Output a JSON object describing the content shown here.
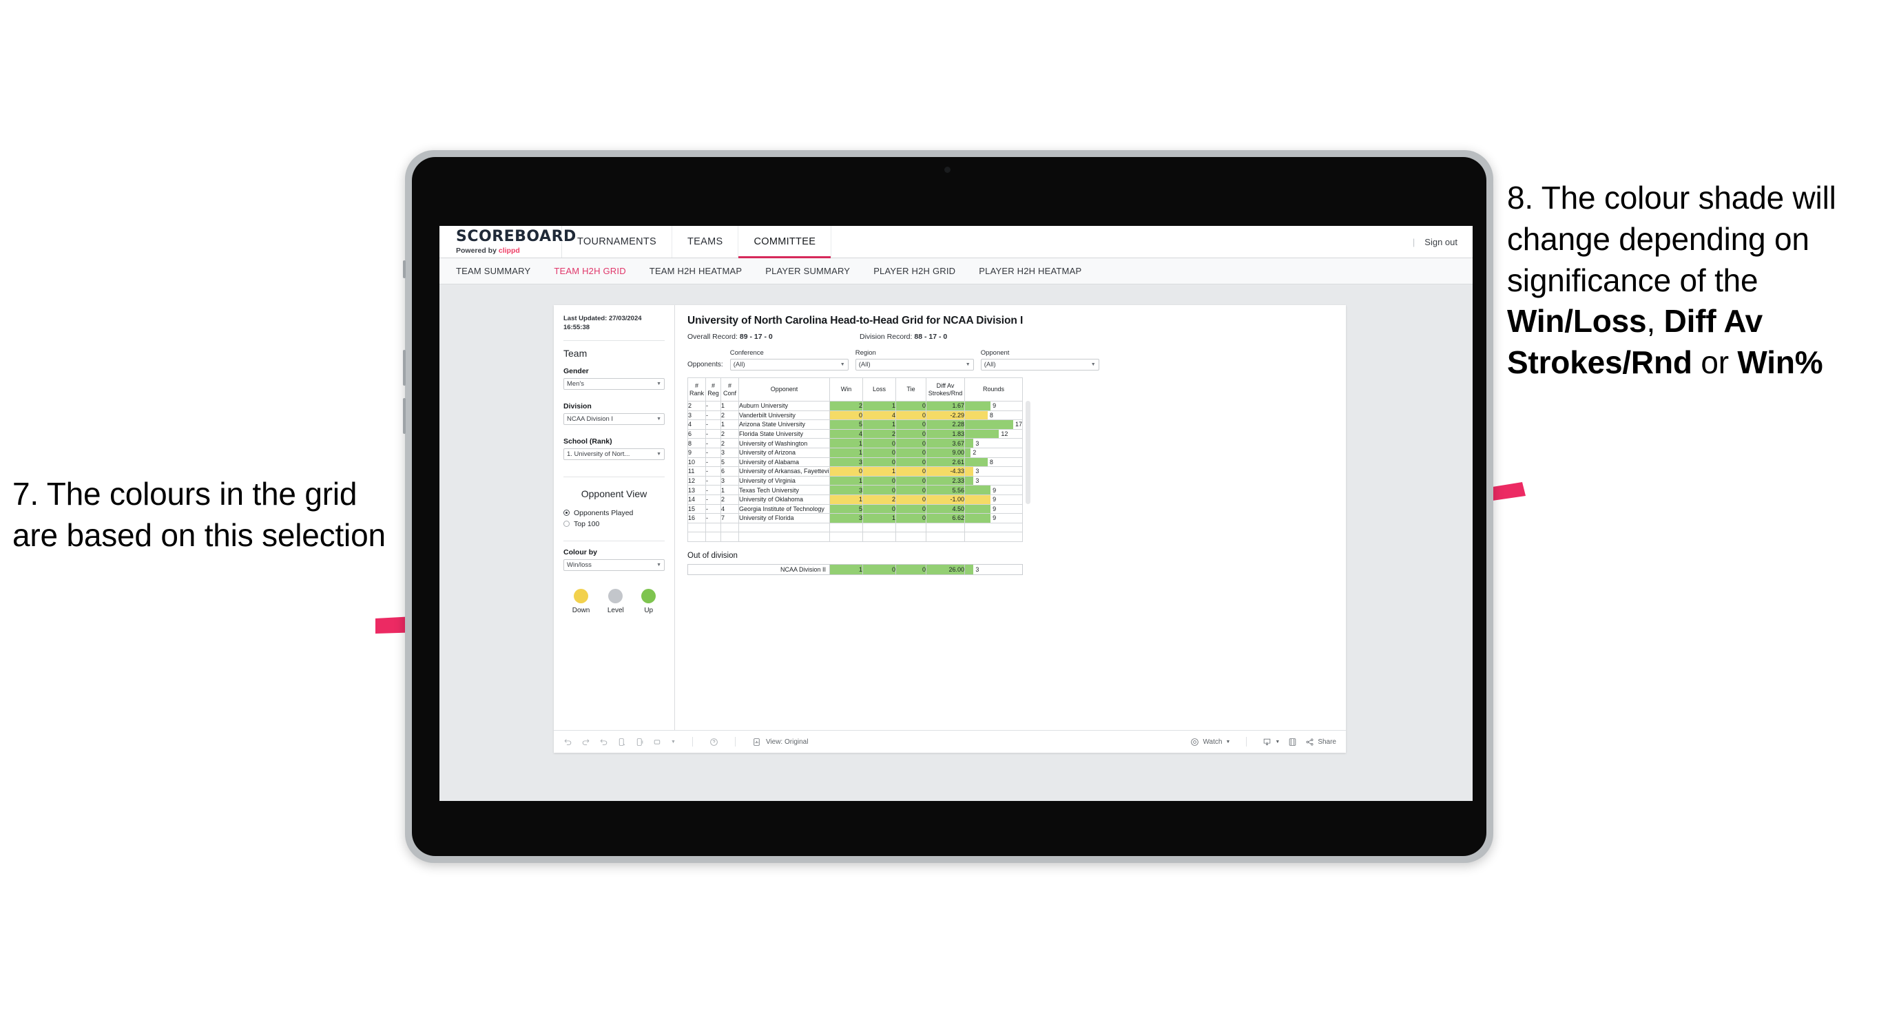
{
  "annotations": {
    "left": {
      "number": "7.",
      "text": "7. The colours in the grid are based on this selection"
    },
    "right": {
      "lead": "8. The colour shade will change depending on significance of the ",
      "bold1": "Win/Loss",
      "mid1": ", ",
      "bold2": "Diff Av Strokes/Rnd",
      "mid2": " or ",
      "bold3": "Win%",
      "arrow_color": "#ec2a63"
    }
  },
  "app": {
    "brand": {
      "name": "SCOREBOARD",
      "powered_prefix": "Powered by ",
      "powered_brand": "clippd"
    },
    "top_nav": [
      {
        "label": "TOURNAMENTS",
        "active": false
      },
      {
        "label": "TEAMS",
        "active": false
      },
      {
        "label": "COMMITTEE",
        "active": true
      }
    ],
    "sign_out": "Sign out",
    "separator": "|",
    "sub_nav": [
      {
        "label": "TEAM SUMMARY",
        "active": false
      },
      {
        "label": "TEAM H2H GRID",
        "active": true
      },
      {
        "label": "TEAM H2H HEATMAP",
        "active": false
      },
      {
        "label": "PLAYER SUMMARY",
        "active": false
      },
      {
        "label": "PLAYER H2H GRID",
        "active": false
      },
      {
        "label": "PLAYER H2H HEATMAP",
        "active": false
      }
    ]
  },
  "sidebar": {
    "last_updated": "Last Updated: 27/03/2024 16:55:38",
    "team_heading": "Team",
    "gender": {
      "label": "Gender",
      "value": "Men's"
    },
    "division": {
      "label": "Division",
      "value": "NCAA Division I"
    },
    "school": {
      "label": "School (Rank)",
      "value": "1. University of Nort..."
    },
    "opponent_view": {
      "heading": "Opponent View",
      "options": [
        {
          "label": "Opponents Played",
          "selected": true
        },
        {
          "label": "Top 100",
          "selected": false
        }
      ]
    },
    "colour_by": {
      "label": "Colour by",
      "value": "Win/loss"
    },
    "legend": [
      {
        "label": "Down",
        "color": "#f2d14d"
      },
      {
        "label": "Level",
        "color": "#c3c6cb"
      },
      {
        "label": "Up",
        "color": "#7ec44f"
      }
    ]
  },
  "main": {
    "title": "University of North Carolina Head-to-Head Grid for NCAA Division I",
    "overall_record_label": "Overall Record: ",
    "overall_record_value": "89 - 17 - 0",
    "division_record_label": "Division Record: ",
    "division_record_value": "88 - 17 - 0",
    "opponents_label": "Opponents:",
    "filters": [
      {
        "label": "Conference",
        "value": "(All)"
      },
      {
        "label": "Region",
        "value": "(All)"
      },
      {
        "label": "Opponent",
        "value": "(All)"
      }
    ]
  },
  "chart_data": {
    "type": "table",
    "title": "University of North Carolina Head-to-Head Grid for NCAA Division I",
    "columns": [
      "# Rank",
      "# Reg",
      "# Conf",
      "Opponent",
      "Win",
      "Loss",
      "Tie",
      "Diff Av Strokes/Rnd",
      "Rounds"
    ],
    "column_headers_two_line": [
      [
        "#",
        "Rank"
      ],
      [
        "#",
        "Reg"
      ],
      [
        "#",
        "Conf"
      ],
      [
        "",
        "Opponent"
      ],
      [
        "",
        "Win"
      ],
      [
        "",
        "Loss"
      ],
      [
        "",
        "Tie"
      ],
      [
        "Diff Av",
        "Strokes/Rnd"
      ],
      [
        "",
        "Rounds"
      ]
    ],
    "rounds_max": 17,
    "colors": {
      "up": "#93cf73",
      "down": "#f5db66",
      "level": "#c3c6cb"
    },
    "rows": [
      {
        "rank": "2",
        "reg": "-",
        "conf": "1",
        "opponent": "Auburn University",
        "win": 2,
        "loss": 1,
        "tie": 0,
        "diff": "1.67",
        "rounds": 9,
        "state": "up"
      },
      {
        "rank": "3",
        "reg": "-",
        "conf": "2",
        "opponent": "Vanderbilt University",
        "win": 0,
        "loss": 4,
        "tie": 0,
        "diff": "-2.29",
        "rounds": 8,
        "state": "down"
      },
      {
        "rank": "4",
        "reg": "-",
        "conf": "1",
        "opponent": "Arizona State University",
        "win": 5,
        "loss": 1,
        "tie": 0,
        "diff": "2.28",
        "rounds": 17,
        "state": "up"
      },
      {
        "rank": "6",
        "reg": "-",
        "conf": "2",
        "opponent": "Florida State University",
        "win": 4,
        "loss": 2,
        "tie": 0,
        "diff": "1.83",
        "rounds": 12,
        "state": "up"
      },
      {
        "rank": "8",
        "reg": "-",
        "conf": "2",
        "opponent": "University of Washington",
        "win": 1,
        "loss": 0,
        "tie": 0,
        "diff": "3.67",
        "rounds": 3,
        "state": "up"
      },
      {
        "rank": "9",
        "reg": "-",
        "conf": "3",
        "opponent": "University of Arizona",
        "win": 1,
        "loss": 0,
        "tie": 0,
        "diff": "9.00",
        "rounds": 2,
        "state": "up"
      },
      {
        "rank": "10",
        "reg": "-",
        "conf": "5",
        "opponent": "University of Alabama",
        "win": 3,
        "loss": 0,
        "tie": 0,
        "diff": "2.61",
        "rounds": 8,
        "state": "up"
      },
      {
        "rank": "11",
        "reg": "-",
        "conf": "6",
        "opponent": "University of Arkansas, Fayetteville",
        "win": 0,
        "loss": 1,
        "tie": 0,
        "diff": "-4.33",
        "rounds": 3,
        "state": "down"
      },
      {
        "rank": "12",
        "reg": "-",
        "conf": "3",
        "opponent": "University of Virginia",
        "win": 1,
        "loss": 0,
        "tie": 0,
        "diff": "2.33",
        "rounds": 3,
        "state": "up"
      },
      {
        "rank": "13",
        "reg": "-",
        "conf": "1",
        "opponent": "Texas Tech University",
        "win": 3,
        "loss": 0,
        "tie": 0,
        "diff": "5.56",
        "rounds": 9,
        "state": "up"
      },
      {
        "rank": "14",
        "reg": "-",
        "conf": "2",
        "opponent": "University of Oklahoma",
        "win": 1,
        "loss": 2,
        "tie": 0,
        "diff": "-1.00",
        "rounds": 9,
        "state": "down"
      },
      {
        "rank": "15",
        "reg": "-",
        "conf": "4",
        "opponent": "Georgia Institute of Technology",
        "win": 5,
        "loss": 0,
        "tie": 0,
        "diff": "4.50",
        "rounds": 9,
        "state": "up"
      },
      {
        "rank": "16",
        "reg": "-",
        "conf": "7",
        "opponent": "University of Florida",
        "win": 3,
        "loss": 1,
        "tie": 0,
        "diff": "6.62",
        "rounds": 9,
        "state": "up"
      }
    ],
    "out_of_division": {
      "title": "Out of division",
      "rows": [
        {
          "label": "NCAA Division II",
          "win": 1,
          "loss": 0,
          "tie": 0,
          "diff": "26.00",
          "rounds": 3,
          "state": "up"
        }
      ]
    }
  },
  "toolbar": {
    "view_label": "View: Original",
    "watch_label": "Watch",
    "share_label": "Share"
  }
}
